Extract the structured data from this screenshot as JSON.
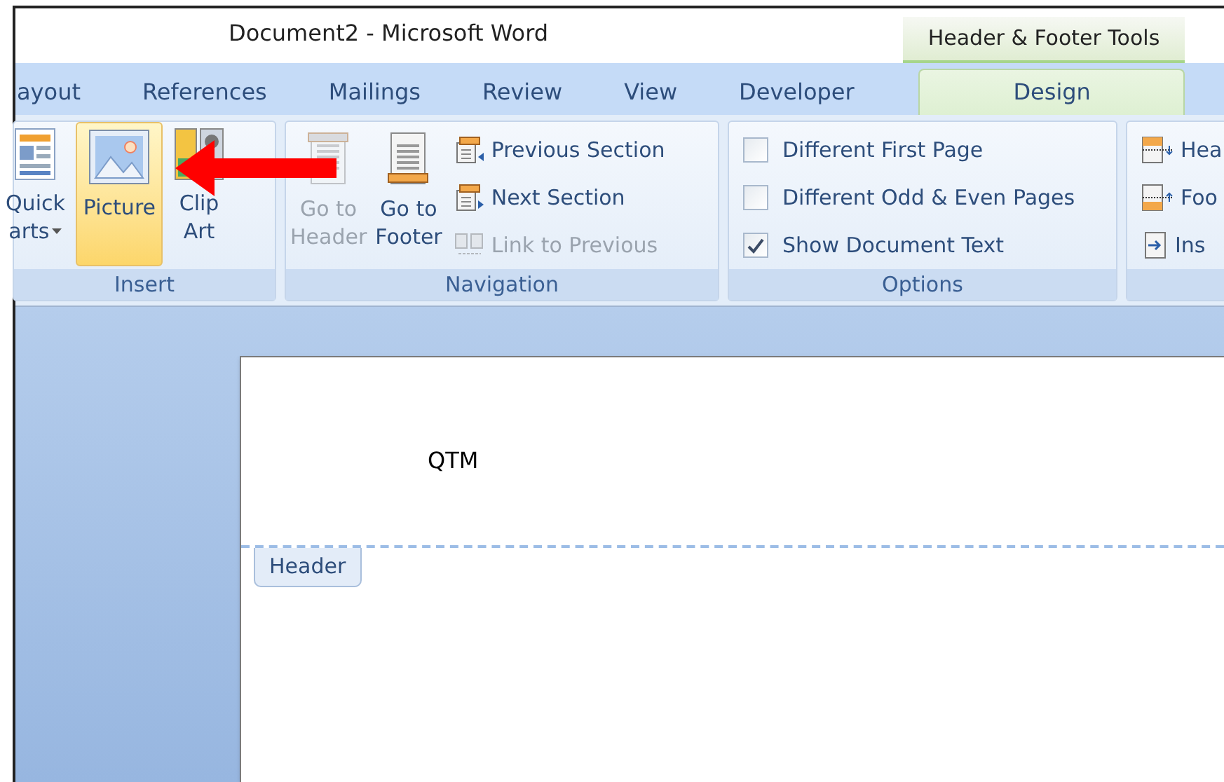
{
  "window": {
    "title": "Document2 - Microsoft Word"
  },
  "contextual_tab_group": {
    "label": "Header & Footer Tools"
  },
  "tabs": [
    {
      "label": "ayout",
      "selected": false
    },
    {
      "label": "References",
      "selected": false
    },
    {
      "label": "Mailings",
      "selected": false
    },
    {
      "label": "Review",
      "selected": false
    },
    {
      "label": "View",
      "selected": false
    },
    {
      "label": "Developer",
      "selected": false
    },
    {
      "label": "Design",
      "selected": true
    }
  ],
  "ribbon": {
    "insert": {
      "label": "Insert",
      "buttons": [
        {
          "kind": "parts",
          "lines": [
            "Quick",
            "arts"
          ],
          "dropdown": true,
          "selected": false
        },
        {
          "kind": "picture",
          "lines": [
            "Picture"
          ],
          "dropdown": false,
          "selected": true
        },
        {
          "kind": "clipart",
          "lines": [
            "Clip",
            "Art"
          ],
          "dropdown": false,
          "selected": false
        }
      ]
    },
    "navigation": {
      "label": "Navigation",
      "large": [
        {
          "kind": "header",
          "lines": [
            "Go to",
            "Header"
          ],
          "disabled": true
        },
        {
          "kind": "footer",
          "lines": [
            "Go to",
            "Footer"
          ],
          "disabled": false
        }
      ],
      "small": [
        {
          "kind": "previous",
          "label": "Previous Section",
          "disabled": false
        },
        {
          "kind": "next",
          "label": "Next Section",
          "disabled": false
        },
        {
          "kind": "link",
          "label": "Link to Previous",
          "disabled": true
        }
      ]
    },
    "options": {
      "label": "Options",
      "checkboxes": [
        {
          "label": "Different First Page",
          "checked": false
        },
        {
          "label": "Different Odd & Even Pages",
          "checked": false
        },
        {
          "label": "Show Document Text",
          "checked": true
        }
      ]
    },
    "position": {
      "items": [
        {
          "kind": "header",
          "label": "Hea"
        },
        {
          "kind": "footer",
          "label": "Foo"
        },
        {
          "kind": "insert",
          "label": "Ins"
        }
      ]
    }
  },
  "document": {
    "header_text": "QTM",
    "header_tag": "Header"
  }
}
